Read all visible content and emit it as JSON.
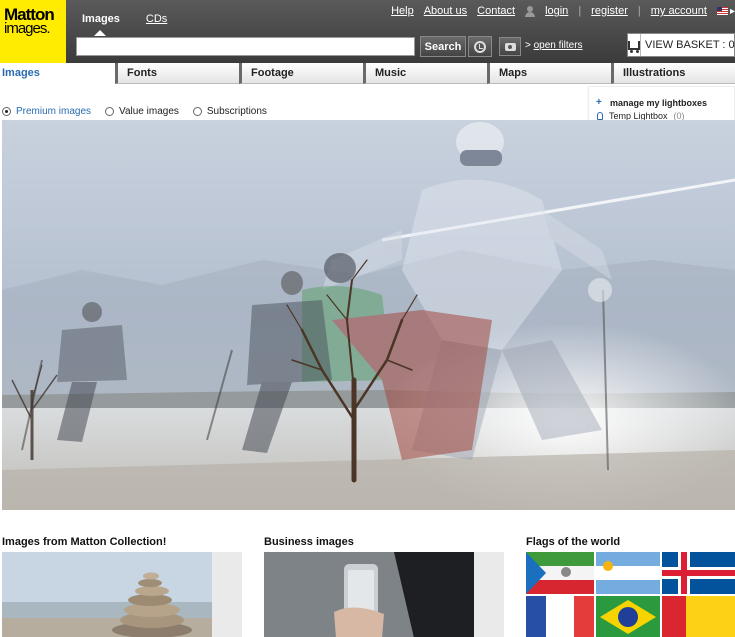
{
  "header": {
    "logo": {
      "line1": "Matton",
      "line2": "images."
    },
    "top_tabs": [
      {
        "label": "Images",
        "active": true
      },
      {
        "label": "CDs",
        "active": false
      }
    ],
    "util_links": {
      "help": "Help",
      "about": "About us",
      "contact": "Contact",
      "login": "login",
      "register": "register",
      "account": "my account",
      "separator": "|",
      "user_icon": "user-icon",
      "flag_icon": "flag-uk-icon"
    },
    "search": {
      "value": "",
      "placeholder": "",
      "button_label": "Search",
      "history_icon": "history-icon",
      "camera_icon": "camera-icon",
      "filters_prefix": ">",
      "filters_label": "open filters"
    },
    "basket": {
      "label": "VIEW BASKET : 0",
      "icon": "cart-icon"
    }
  },
  "category_tabs": [
    {
      "label": "Images",
      "active": true
    },
    {
      "label": "Fonts",
      "active": false
    },
    {
      "label": "Footage",
      "active": false
    },
    {
      "label": "Music",
      "active": false
    },
    {
      "label": "Maps",
      "active": false
    },
    {
      "label": "Illustrations",
      "active": false
    }
  ],
  "license_options": [
    {
      "label": "Premium images",
      "selected": true
    },
    {
      "label": "Value images",
      "selected": false
    },
    {
      "label": "Subscriptions",
      "selected": false
    }
  ],
  "lightbox": {
    "manage_label": "manage my lightboxes",
    "temp_label": "Temp Lightbox",
    "temp_count": "(0)"
  },
  "sections": [
    {
      "title": "Images from Matton Collection!"
    },
    {
      "title": "Business images"
    },
    {
      "title": "Flags of the world"
    }
  ],
  "colors": {
    "header_bg": "#4a4a4a",
    "logo_bg": "#ffec00",
    "accent_blue": "#2a6bb0"
  }
}
